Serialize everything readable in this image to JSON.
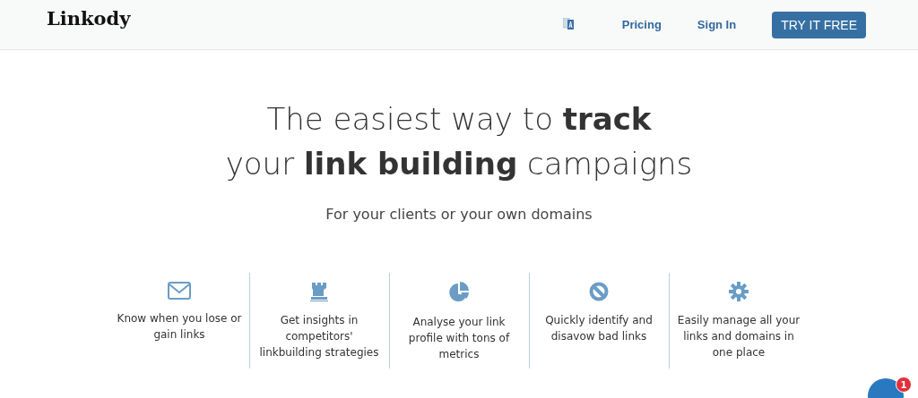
{
  "header": {
    "logo": "Linkody",
    "nav": [
      {
        "kind": "language"
      },
      {
        "kind": "link",
        "label": "Pricing"
      },
      {
        "kind": "link",
        "label": "Sign In"
      },
      {
        "kind": "button",
        "label": "TRY IT FREE"
      }
    ]
  },
  "hero": {
    "headline_lines": [
      "The easiest way to **track**",
      "your **link building** campaigns"
    ],
    "subtitle": "For your clients or your own domains"
  },
  "features": [
    {
      "kind": "envelope",
      "text": "Know when you lose or gain links"
    },
    {
      "kind": "rook",
      "text": "Get insights in competitors' linkbuilding strategies"
    },
    {
      "kind": "pie",
      "text": "Analyse your link profile with tons of metrics"
    },
    {
      "kind": "ban",
      "text": "Quickly identify and disavow bad links"
    },
    {
      "kind": "gear",
      "text": "Easily manage all your links and domains in one place"
    }
  ],
  "chat": {
    "badge": "1"
  }
}
